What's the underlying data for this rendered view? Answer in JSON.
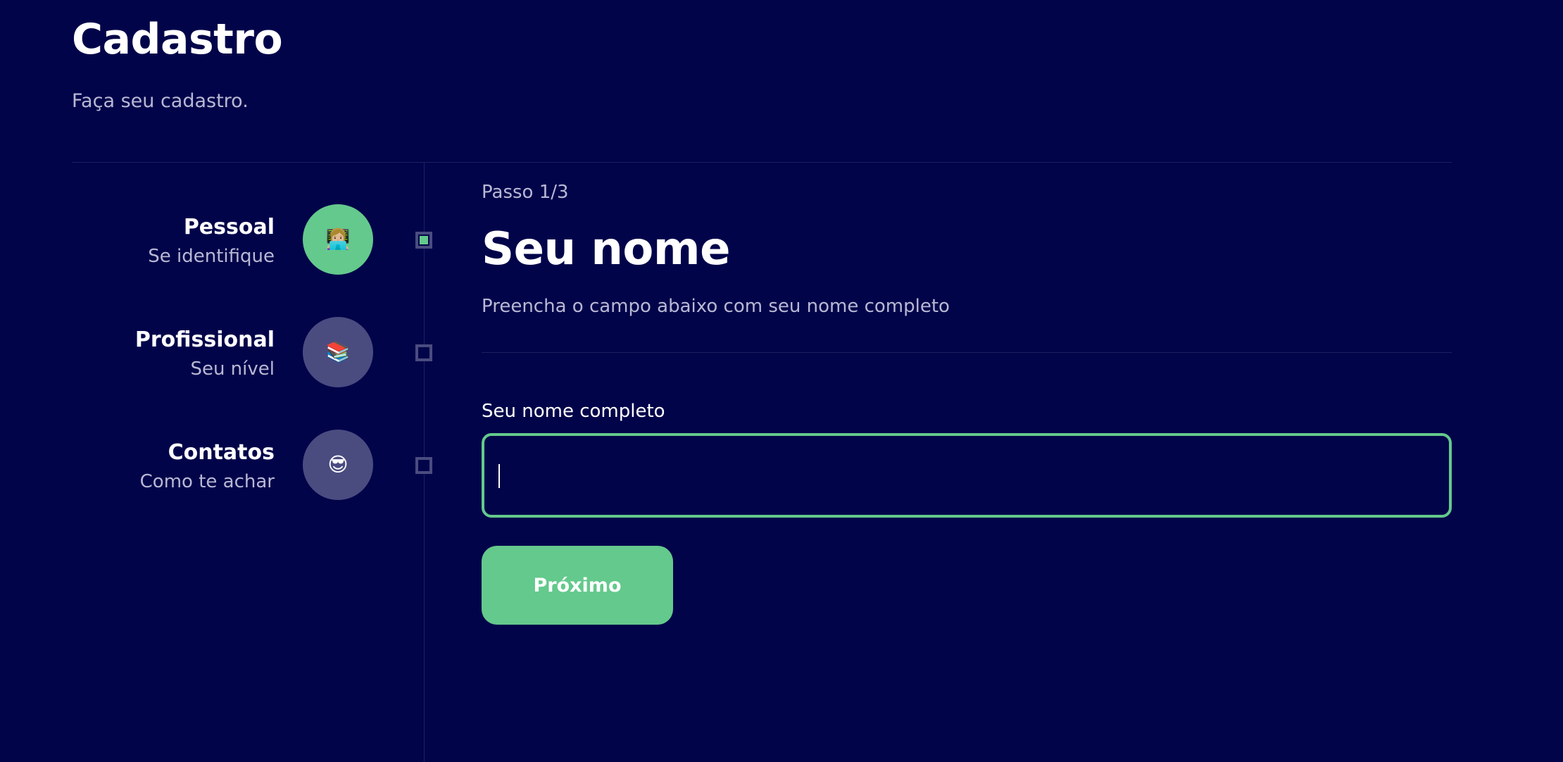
{
  "header": {
    "title": "Cadastro",
    "subtitle": "Faça seu cadastro."
  },
  "steps": [
    {
      "title": "Pessoal",
      "description": "Se identifique",
      "icon": "👩🏼‍💻",
      "icon_name": "woman-technologist-icon",
      "active": true
    },
    {
      "title": "Profissional",
      "description": "Seu nível",
      "icon": "📚",
      "icon_name": "books-icon",
      "active": false
    },
    {
      "title": "Contatos",
      "description": "Como te achar",
      "icon": "😎",
      "icon_name": "sunglasses-face-icon",
      "active": false
    }
  ],
  "content": {
    "step_count": "Passo 1/3",
    "title": "Seu nome",
    "description": "Preencha o campo abaixo com seu nome completo",
    "field_label": "Seu nome completo",
    "field_value": "",
    "next_label": "Próximo"
  },
  "colors": {
    "background": "#02044a",
    "accent": "#64c98c",
    "inactive": "#4a4c80",
    "muted_text": "#b8b8d4",
    "divider": "#1c1f5e"
  }
}
